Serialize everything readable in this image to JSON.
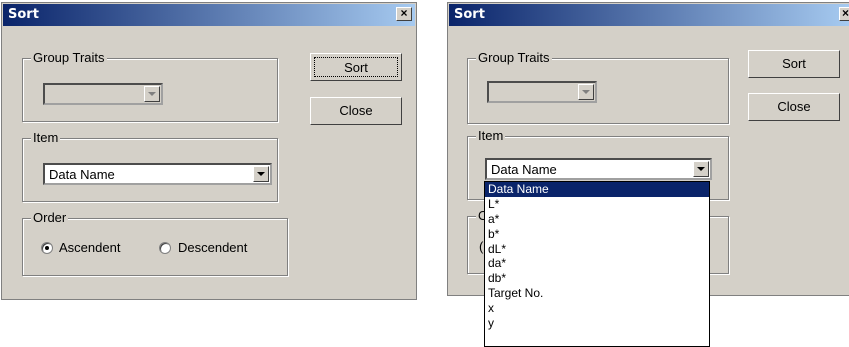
{
  "left_dialog": {
    "title": "Sort",
    "close_glyph": "×",
    "group_traits_label": "Group Traits",
    "group_traits_value": "",
    "item_label": "Item",
    "item_value": "Data Name",
    "order_label": "Order",
    "ascendent_label": "Ascendent",
    "descendent_label": "Descendent",
    "order_selected": "Ascendent",
    "sort_button": "Sort",
    "close_button": "Close"
  },
  "right_dialog": {
    "title": "Sort",
    "close_glyph": "×",
    "group_traits_label": "Group Traits",
    "item_label": "Item",
    "item_value": "Data Name",
    "order_label_partial": "O",
    "radio_partial": "(",
    "sort_button": "Sort",
    "close_button": "Close",
    "dropdown_options": [
      "Data Name",
      "L*",
      "a*",
      "b*",
      "dL*",
      "da*",
      "db*",
      "Target No.",
      "x",
      "y"
    ],
    "dropdown_selected": "Data Name"
  },
  "colors": {
    "titlebar_start": "#0a246a",
    "titlebar_end": "#a6caf0",
    "dialog_bg": "#d4d0c8",
    "selection": "#0a246a"
  },
  "icons": {
    "dropdown_arrow": "triangle-down",
    "close": "x-glyph",
    "radio": "circle"
  }
}
